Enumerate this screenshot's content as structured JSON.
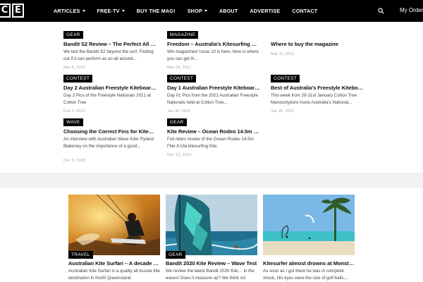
{
  "logo": {
    "letters": [
      "C",
      "E"
    ]
  },
  "nav": {
    "items": [
      {
        "label": "ARTICLES",
        "dropdown": true
      },
      {
        "label": "FREE-TV",
        "dropdown": true
      },
      {
        "label": "BUY THE MAG!",
        "dropdown": false
      },
      {
        "label": "SHOP",
        "dropdown": true
      },
      {
        "label": "ABOUT",
        "dropdown": false
      },
      {
        "label": "ADVERTISE",
        "dropdown": false
      },
      {
        "label": "CONTACT",
        "dropdown": false
      }
    ],
    "search_icon": "search-icon",
    "my_order": "My Order"
  },
  "posts": [
    {
      "tag": "GEAR",
      "title": "Bandit S2 Review – The Perfect All Rou...",
      "excerpt": "We test the Bandit S2 beyond the surf. Finding out if it can perform as an all around...",
      "date": "Mar 5, 2022"
    },
    {
      "tag": "MAGAZINE",
      "title": "Freedom – Australia's Kitesurfing Mag...",
      "excerpt": "Win magazines! Issue 10 is here, here is where you can get it!...",
      "date": "Mar 24, 2021"
    },
    {
      "tag": "",
      "title": "Where to buy the magazine",
      "excerpt": "",
      "date": "Mar 11, 2021"
    },
    {
      "tag": "CONTEST",
      "title": "Day 2 Australian Freestyle Kiteboardin...",
      "excerpt": "Day 2 Pics of the Freestyle Nationals 2021 at Cotton Tree",
      "date": "Feb 3, 2021"
    },
    {
      "tag": "CONTEST",
      "title": "Day 1 Australian Freestyle Kiteboarding Nati...",
      "excerpt": "Day 01 Pics from the 2021 Australian Freestyle Nationals held at Cotton Tree...",
      "date": "Jan 30, 2021"
    },
    {
      "tag": "CONTEST",
      "title": "Best of Australia's Freestyle Kiteboard...",
      "excerpt": "This week from 28-31st January Cotton Tree Maroochydore hosts Australia's National...",
      "date": "Jan 25, 2021"
    },
    {
      "tag": "WAVE",
      "title": "Choosing the Correct Fins for Kitesurfi...",
      "excerpt": "An interview with Australian Wave Kiter Ryland Blakeney on the importance of a good...",
      "date": "Dec 9, 2020"
    },
    {
      "tag": "GEAR",
      "title": "Kite Review – Ocean Rodeo 14.5m Flite...",
      "excerpt": "Full riders review of the Ocean Rodeo 14.5m Flite A:Ula kitesurfing Kite.",
      "date": "Nov 12, 2020"
    }
  ],
  "featured": [
    {
      "tag": "TRAVEL",
      "title": "Australian Kite Surfari – A decade of ad...",
      "excerpt": "Australian Kite Surfari is a quality all Aussie kite destination in North Queensland."
    },
    {
      "tag": "GEAR",
      "title": "Bandit 2020 Kite Review – Wave Test",
      "excerpt": "We review the latest Bandit 2020 Kite… in the waves! Does it measure up? We think so!"
    },
    {
      "tag": "",
      "title": "Kitesurfer almost drowns at Monster 20...",
      "excerpt": "As soon as I got there he was in complete shock. His eyes were the size of golf balls,..."
    }
  ],
  "colors": {
    "nav_bg": "#000000",
    "tag_bg": "#000000",
    "band_bg": "#f2f2f2",
    "date_text": "#aaaaaa"
  }
}
